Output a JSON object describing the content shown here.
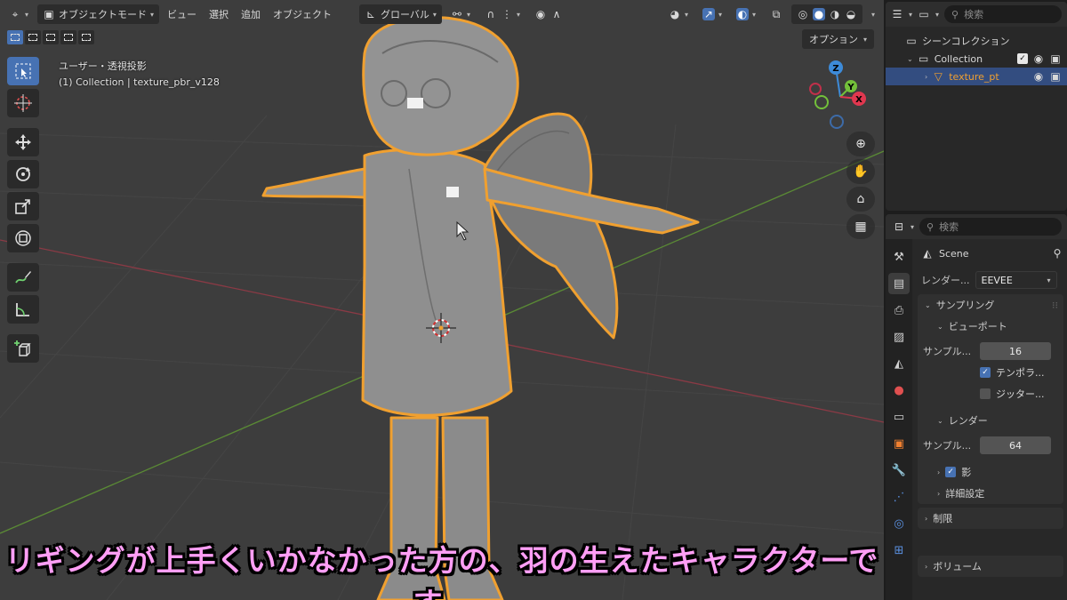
{
  "header": {
    "editor_icon": "transform-gizmo-icon",
    "mode": "オブジェクトモード",
    "menus": [
      "ビュー",
      "選択",
      "追加",
      "オブジェクト"
    ],
    "orientation": "グローバル"
  },
  "options_label": "オプション",
  "viewport_info": {
    "line1": "ユーザー・透視投影",
    "line2": "(1) Collection | texture_pbr_v128"
  },
  "gizmo": {
    "x": "X",
    "y": "Y",
    "z": "Z"
  },
  "subtitle": "リギングが上手くいかなかった方の、羽の生えたキャラクターです。",
  "outliner": {
    "search_placeholder": "検索",
    "scene_collection": "シーンコレクション",
    "collection": "Collection",
    "object": "texture_pt"
  },
  "properties": {
    "search_placeholder": "検索",
    "scene": "Scene",
    "render_engine_label": "レンダー...",
    "render_engine": "EEVEE",
    "sampling": "サンプリング",
    "viewport": "ビューポート",
    "viewport_samples_label": "サンプル...",
    "viewport_samples": "16",
    "temporal_label": "テンポラ...",
    "jitter_label": "ジッター...",
    "render": "レンダー",
    "render_samples_label": "サンプル...",
    "render_samples": "64",
    "shadows": "影",
    "advanced": "詳細設定",
    "limits": "制限",
    "volumes": "ボリューム"
  },
  "colors": {
    "accent": "#4772b3",
    "selection_outline": "#f0a030",
    "x_axis": "#e0374f",
    "y_axis": "#73c03a",
    "z_axis": "#3d8bd9",
    "subtitle_fill": "#ff9ef5"
  }
}
